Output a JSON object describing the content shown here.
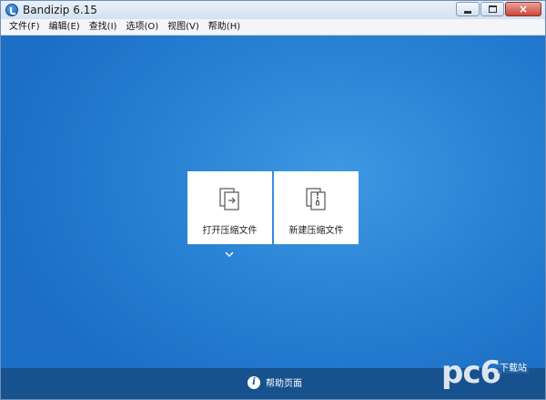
{
  "window": {
    "title": "Bandizip 6.15",
    "controls": {
      "minimize": "minimize",
      "maximize": "maximize",
      "close": "×"
    }
  },
  "menu": {
    "items": [
      {
        "label": "文件(F)"
      },
      {
        "label": "编辑(E)"
      },
      {
        "label": "查找(I)"
      },
      {
        "label": "选项(O)"
      },
      {
        "label": "视图(V)"
      },
      {
        "label": "帮助(H)"
      }
    ]
  },
  "main": {
    "tiles": [
      {
        "label": "打开压缩文件",
        "icon": "open-archive-icon"
      },
      {
        "label": "新建压缩文件",
        "icon": "new-archive-icon"
      }
    ],
    "more_icon": "chevron-down-icon"
  },
  "footer": {
    "help_label": "帮助页面",
    "help_icon": "i"
  },
  "watermark": {
    "brand": "pc6",
    "sub": "下载站"
  },
  "colors": {
    "main_bg": "#2b84d6",
    "footer_bg": "#17528f",
    "tile_bg": "#ffffff"
  }
}
